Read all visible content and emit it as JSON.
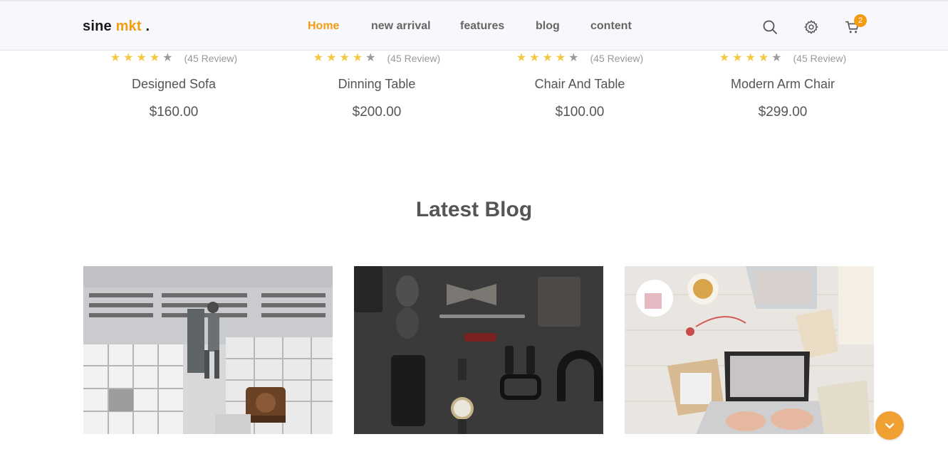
{
  "header": {
    "logo_main": "sine ",
    "logo_accent": "mkt",
    "logo_dot": " .",
    "nav": [
      {
        "label": "Home",
        "active": true
      },
      {
        "label": "new arrival"
      },
      {
        "label": "features"
      },
      {
        "label": "blog"
      },
      {
        "label": "content"
      }
    ],
    "cart_count": "2",
    "accent_color": "#f39c12",
    "icons": [
      "search-icon",
      "gear-icon",
      "cart-icon"
    ]
  },
  "products": [
    {
      "name": "Designed Sofa",
      "price": "$160.00",
      "rating": 4,
      "max_rating": 5,
      "reviews": "(45 Review)"
    },
    {
      "name": "Dinning Table",
      "price": "$200.00",
      "rating": 4,
      "max_rating": 5,
      "reviews": "(45 Review)"
    },
    {
      "name": "Chair And Table",
      "price": "$100.00",
      "rating": 4,
      "max_rating": 5,
      "reviews": "(45 Review)"
    },
    {
      "name": "Modern Arm Chair",
      "price": "$299.00",
      "rating": 4,
      "max_rating": 5,
      "reviews": "(45 Review)"
    }
  ],
  "blog": {
    "title": "Latest Blog",
    "images": [
      "store-interior-photo",
      "flat-lay-accessories-photo",
      "desk-workspace-photo"
    ]
  },
  "scroll_button": {
    "icon": "chevron-down-icon",
    "color": "#f0a030"
  }
}
